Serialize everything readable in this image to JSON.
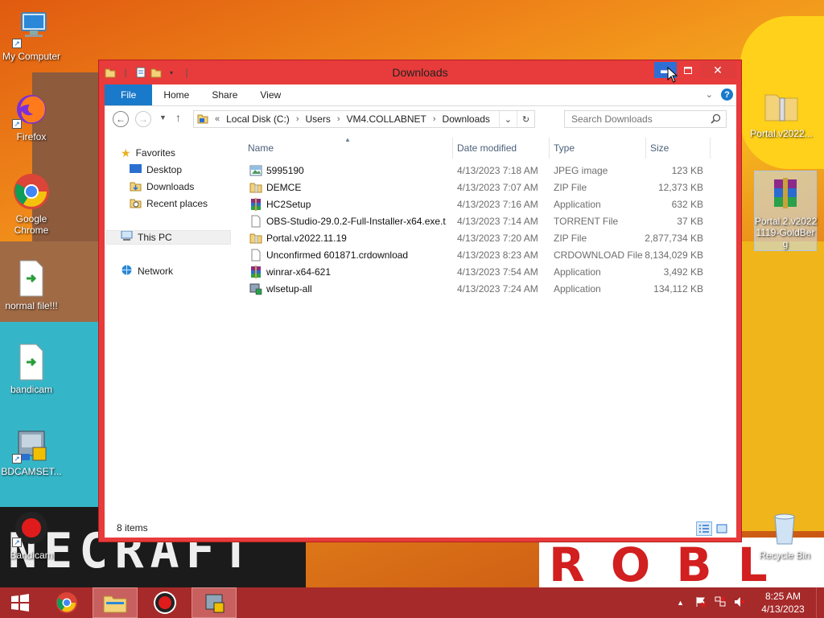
{
  "desktop": {
    "icons_left": [
      {
        "label": "My Computer",
        "icon": "computer-icon"
      },
      {
        "label": "Firefox",
        "icon": "firefox-icon"
      },
      {
        "label": "Google Chrome",
        "icon": "chrome-icon"
      },
      {
        "label": "normal file!!!",
        "icon": "file-icon"
      },
      {
        "label": "bandicam",
        "icon": "file-icon"
      },
      {
        "label": "BDCAMSET...",
        "icon": "installer-icon"
      },
      {
        "label": "Bandicam",
        "icon": "bandicam-icon"
      }
    ],
    "icons_right": [
      {
        "label": "Portal.v2022...",
        "icon": "zip-folder-icon"
      },
      {
        "label": "Portal.2.v2022 1119-GoldBer g",
        "icon": "winrar-icon"
      },
      {
        "label": "Recycle Bin",
        "icon": "recycle-bin-icon"
      }
    ]
  },
  "window": {
    "title": "Downloads",
    "ribbon_tabs": [
      "File",
      "Home",
      "Share",
      "View"
    ],
    "address": {
      "prefix": "«",
      "crumbs": [
        "Local Disk (C:)",
        "Users",
        "VM4.COLLABNET",
        "Downloads"
      ]
    },
    "search_placeholder": "Search Downloads",
    "nav": {
      "favorites": "Favorites",
      "favorites_items": [
        "Desktop",
        "Downloads",
        "Recent places"
      ],
      "this_pc": "This PC",
      "network": "Network"
    },
    "columns": [
      "Name",
      "Date modified",
      "Type",
      "Size"
    ],
    "files": [
      {
        "name": "5995190",
        "date": "4/13/2023 7:18 AM",
        "type": "JPEG image",
        "size": "123 KB",
        "icon": "image-file-icon"
      },
      {
        "name": "DEMCE",
        "date": "4/13/2023 7:07 AM",
        "type": "ZIP File",
        "size": "12,373 KB",
        "icon": "zip-file-icon"
      },
      {
        "name": "HC2Setup",
        "date": "4/13/2023 7:16 AM",
        "type": "Application",
        "size": "632 KB",
        "icon": "winrar-app-icon"
      },
      {
        "name": "OBS-Studio-29.0.2-Full-Installer-x64.exe.t...",
        "date": "4/13/2023 7:14 AM",
        "type": "TORRENT File",
        "size": "37 KB",
        "icon": "blank-file-icon"
      },
      {
        "name": "Portal.v2022.11.19",
        "date": "4/13/2023 7:20 AM",
        "type": "ZIP File",
        "size": "2,877,734 KB",
        "icon": "zip-file-icon"
      },
      {
        "name": "Unconfirmed 601871.crdownload",
        "date": "4/13/2023 8:23 AM",
        "type": "CRDOWNLOAD File",
        "size": "8,134,029 KB",
        "icon": "blank-file-icon"
      },
      {
        "name": "winrar-x64-621",
        "date": "4/13/2023 7:54 AM",
        "type": "Application",
        "size": "3,492 KB",
        "icon": "winrar-app-icon"
      },
      {
        "name": "wlsetup-all",
        "date": "4/13/2023 7:24 AM",
        "type": "Application",
        "size": "134,112 KB",
        "icon": "setup-app-icon"
      }
    ],
    "status": "8 items"
  },
  "taskbar": {
    "time": "8:25 AM",
    "date": "4/13/2023"
  },
  "colors": {
    "window_frame": "#e83b3b",
    "taskbar": "#a62a2a",
    "accent_blue": "#1979ca"
  }
}
